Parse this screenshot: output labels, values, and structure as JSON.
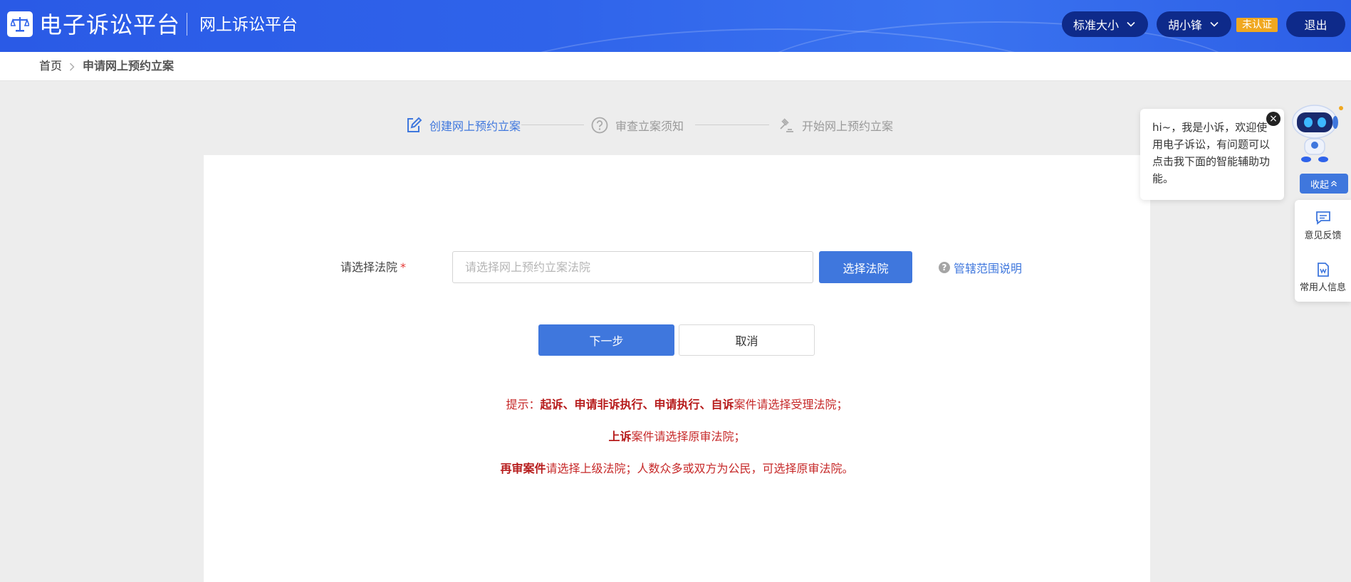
{
  "header": {
    "title": "电子诉讼平台",
    "subtitle": "网上诉讼平台",
    "font_size_label": "标准大小",
    "user_name": "胡小锋",
    "auth_badge": "未认证",
    "logout_label": "退出"
  },
  "breadcrumb": {
    "home": "首页",
    "current": "申请网上预约立案"
  },
  "steps": [
    {
      "label": "创建网上预约立案",
      "state": "active",
      "icon": "edit-icon"
    },
    {
      "label": "审查立案须知",
      "state": "inactive",
      "icon": "question-circle-icon"
    },
    {
      "label": "开始网上预约立案",
      "state": "inactive",
      "icon": "gavel-icon"
    }
  ],
  "form": {
    "court_label": "请选择法院",
    "required_mark": "*",
    "court_placeholder": "请选择网上预约立案法院",
    "select_court_button": "选择法院",
    "jurisdiction_help": "管辖范围说明",
    "next_button": "下一步",
    "cancel_button": "取消"
  },
  "tips": {
    "line1_prefix": "提示：",
    "line1_bold": "起诉、申请非诉执行、申请执行、自诉",
    "line1_rest": "案件请选择受理法院；",
    "line2_bold": "上诉",
    "line2_rest": "案件请选择原审法院；",
    "line3_bold": "再审案件",
    "line3_rest": "请选择上级法院；人数众多或双方为公民，可选择原审法院。"
  },
  "assistant": {
    "greeting": "hi~，我是小诉，欢迎使用电子诉讼，有问题可以点击我下面的智能辅助功能。",
    "collapse_label": "收起",
    "feedback_label": "意见反馈",
    "contacts_label": "常用人信息"
  },
  "colors": {
    "header_blue": "#2f63ea",
    "primary": "#3f77dd",
    "tip_red": "#c62828",
    "badge": "#f0a820"
  }
}
